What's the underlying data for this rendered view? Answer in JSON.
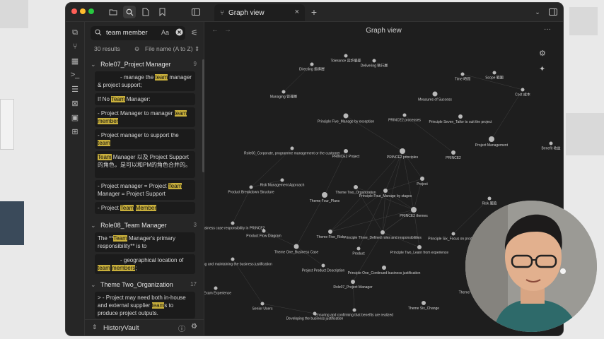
{
  "app": {
    "tab_title": "Graph view",
    "view_title": "Graph view",
    "vault_name": "HistoryVault"
  },
  "search": {
    "query": "team member",
    "match_case_label": "Aa",
    "results_count": "30 results",
    "sort_label": "File name (A to Z)"
  },
  "results": [
    {
      "title": "Role07_Project Manager",
      "count": "9",
      "snippets": [
        [
          {
            "t": "- manage the "
          },
          {
            "t": "team",
            "h": true
          },
          {
            "t": " manager & project support;"
          }
        ],
        [
          {
            "t": "If No "
          },
          {
            "t": "Team",
            "h": true
          },
          {
            "t": " Manager:"
          }
        ],
        [
          {
            "t": "- Project Manager to manager "
          },
          {
            "t": "team",
            "h": true
          },
          {
            "t": " "
          },
          {
            "t": "member",
            "h": true
          }
        ],
        [
          {
            "t": "- Project manager to support the "
          },
          {
            "t": "team",
            "h": true
          }
        ],
        [
          {
            "t": "Team",
            "h": true
          },
          {
            "t": " Manager 以及 Project Support的角色，是可以和PM的角色合并的。"
          }
        ],
        [
          {
            "t": "- Project manager = Project "
          },
          {
            "t": "Team",
            "h": true
          },
          {
            "t": " Manager = Project Support"
          }
        ],
        [
          {
            "t": "- Project "
          },
          {
            "t": "Team",
            "h": true
          },
          {
            "t": " "
          },
          {
            "t": "Member",
            "h": true
          }
        ]
      ]
    },
    {
      "title": "Role08_Team Manager",
      "count": "3",
      "snippets": [
        [
          {
            "t": "The **"
          },
          {
            "t": "Team",
            "h": true
          },
          {
            "t": " Manager's primary responsibility** is to"
          }
        ],
        [
          {
            "t": "- geographical location of "
          },
          {
            "t": "team",
            "h": true
          },
          {
            "t": " "
          },
          {
            "t": "members",
            "h": true
          },
          {
            "t": ";"
          }
        ]
      ]
    },
    {
      "title": "Theme Two_Organization",
      "count": "17",
      "snippets": [
        [
          {
            "t": "> - Project may need both in-house and external supplier "
          },
          {
            "t": "team",
            "h": true
          },
          {
            "t": "s to produce project outputs."
          }
        ]
      ]
    }
  ],
  "icons": {
    "ribbon": [
      "files-icon",
      "graph-icon",
      "grid-icon",
      "terminal-icon",
      "kanban-icon",
      "canvas-icon",
      "template-icon",
      "dashboard-icon"
    ],
    "titlebar": [
      "folder-icon",
      "search-icon",
      "file-icon",
      "bookmark-icon",
      "sidebar-toggle-icon"
    ]
  },
  "colors": {
    "window_bg": "#1e1e1e",
    "panel_bg": "#262626",
    "highlight": "#c9b03c",
    "node": "#b9b9b9"
  },
  "graph": {
    "nodes": [
      {
        "label": "Tolerance 容許偏差"
      },
      {
        "label": "Delivering 執行層"
      },
      {
        "label": "Directing 指導層"
      },
      {
        "label": "Time 時間"
      },
      {
        "label": "Scope 範圍"
      },
      {
        "label": "Cost 成本"
      },
      {
        "label": "Managing 管理層"
      },
      {
        "label": "Measures of Success"
      },
      {
        "label": "PRINCE2 processes"
      },
      {
        "label": "Principle Five_Manage by exception"
      },
      {
        "label": "Principle Seven_Tailor to suit the project"
      },
      {
        "label": "Project Management"
      },
      {
        "label": "Benefit 收益"
      },
      {
        "label": "Role00_Corporate, programme management or the customer"
      },
      {
        "label": "PRINCE2 Project"
      },
      {
        "label": "PRINCE2 principles"
      },
      {
        "label": "PRINCE2"
      },
      {
        "label": "Risk Management Approach"
      },
      {
        "label": "Project"
      },
      {
        "label": "Product Breakdown Structure"
      },
      {
        "label": "Theme Two_Organization"
      },
      {
        "label": "Principle Four_Manage by stages"
      },
      {
        "label": "Theme Four_Plans"
      },
      {
        "label": "Risk 風險"
      },
      {
        "label": "PRINCE2 themes"
      },
      {
        "label": "Business case responsibility in PRINCE2"
      },
      {
        "label": "Product Flow Diagram"
      },
      {
        "label": "Theme Five_Risk"
      },
      {
        "label": "Principle Three_Defined roles and responsibilities"
      },
      {
        "label": "Principle Six_Focus on products"
      },
      {
        "label": "Theme One_Business Case"
      },
      {
        "label": "Product"
      },
      {
        "label": "Principle Two_Learn from experience"
      },
      {
        "label": "Verifying and maintaining the business justification"
      },
      {
        "label": "Project Product Description"
      },
      {
        "label": "Principle One_Continued business justification"
      },
      {
        "label": "Role07_Project Manager"
      },
      {
        "label": "Theme Three_..."
      },
      {
        "label": "C Exam Experience"
      },
      {
        "label": "Senior Users"
      },
      {
        "label": "Ensuring and confirming that benefits are realized"
      },
      {
        "label": "Developing the business justification"
      },
      {
        "label": "Theme Six_Change"
      }
    ]
  }
}
